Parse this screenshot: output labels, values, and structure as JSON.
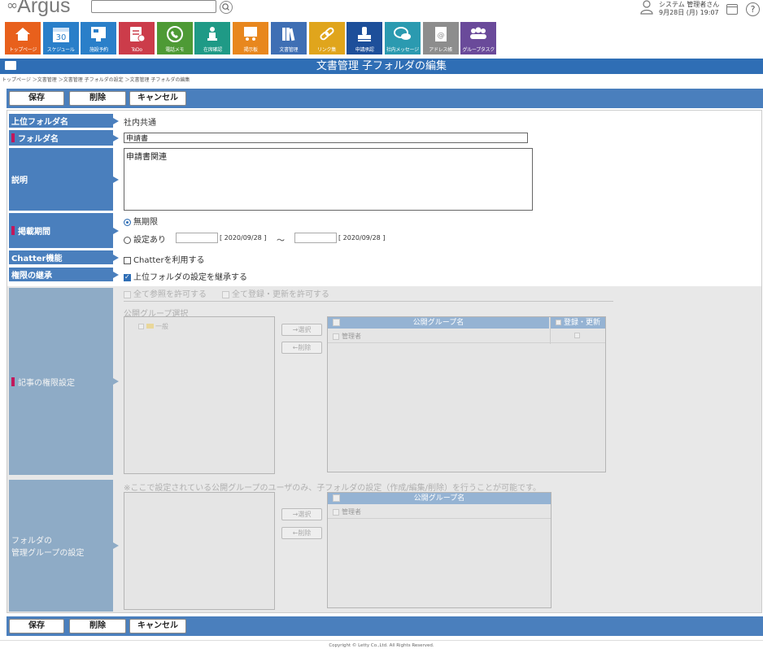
{
  "header": {
    "logo_text": "Argus",
    "search": {
      "value": "",
      "placeholder": ""
    },
    "user_name": "システム 管理者さん",
    "datetime": "9月28日 (月) 19:07"
  },
  "apps": [
    {
      "label": "トップページ",
      "color": "#e8601c",
      "icon": "home-icon"
    },
    {
      "label": "スケジュール",
      "color": "#2a7fc9",
      "icon": "calendar-icon"
    },
    {
      "label": "施設予約",
      "color": "#2a7fc9",
      "icon": "facility-icon"
    },
    {
      "label": "ToDo",
      "color": "#cc3c4a",
      "icon": "todo-icon"
    },
    {
      "label": "電話メモ",
      "color": "#4e9a35",
      "icon": "phone-icon"
    },
    {
      "label": "在席確認",
      "color": "#1f9a86",
      "icon": "presence-icon"
    },
    {
      "label": "掲示板",
      "color": "#e8871e",
      "icon": "board-icon"
    },
    {
      "label": "文書管理",
      "color": "#3f6fb4",
      "icon": "document-icon"
    },
    {
      "label": "リンク集",
      "color": "#e0a51c",
      "icon": "link-icon"
    },
    {
      "label": "申請承認",
      "color": "#1d4f9a",
      "icon": "stamp-icon"
    },
    {
      "label": "社内メッセージ",
      "color": "#2b9ab0",
      "icon": "message-icon"
    },
    {
      "label": "アドレス帳",
      "color": "#8d8d8d",
      "icon": "address-icon"
    },
    {
      "label": "グループタスク",
      "color": "#6a4a9a",
      "icon": "group-icon"
    }
  ],
  "page_title": "文書管理 子フォルダの編集",
  "breadcrumb": "トップページ ＞文書管理 ＞文書管理 子フォルダの設定 ＞文書管理 子フォルダの編集",
  "buttons": {
    "save": "保存",
    "delete": "削除",
    "cancel": "キャンセル"
  },
  "form": {
    "parent_folder": {
      "label": "上位フォルダ名",
      "value": "社内共通"
    },
    "folder_name": {
      "label": "フォルダ名",
      "value": "申請書"
    },
    "description": {
      "label": "説明",
      "value": "申請書関連"
    },
    "period": {
      "label": "掲載期間",
      "unlimited": "無期限",
      "custom": "設定あり",
      "from_date": "[ 2020/09/28 ]",
      "tilde": "～",
      "to_date": "[ 2020/09/28 ]"
    },
    "chatter": {
      "label": "Chatter機能",
      "option": "Chatterを利用する"
    },
    "inherit": {
      "label": "権限の継承",
      "option": "上位フォルダの設定を継承する"
    },
    "permission": {
      "label": "記事の権限設定",
      "allow_view_all": "全て参照を許可する",
      "allow_edit_all": "全て登録・更新を許可する",
      "group_select_title": "公開グループ選択",
      "tree_item": "一般",
      "select_btn": "→選択",
      "remove_btn": "←削除",
      "col_group": "公開グループ名",
      "col_edit": "登録・更新",
      "rows": [
        "管理者"
      ]
    },
    "manage_group": {
      "label_line1": "フォルダの",
      "label_line2": "管理グループの設定",
      "note": "※ここで設定されている公開グループのユーザのみ、子フォルダの設定（作成/編集/削除）を行うことが可能です。",
      "select_btn": "→選択",
      "remove_btn": "←削除",
      "col_group": "公開グループ名",
      "rows": [
        "管理者"
      ]
    }
  },
  "footer": {
    "copyright": "Copyright © Letty Co.,Ltd. All Rights Reserved."
  }
}
